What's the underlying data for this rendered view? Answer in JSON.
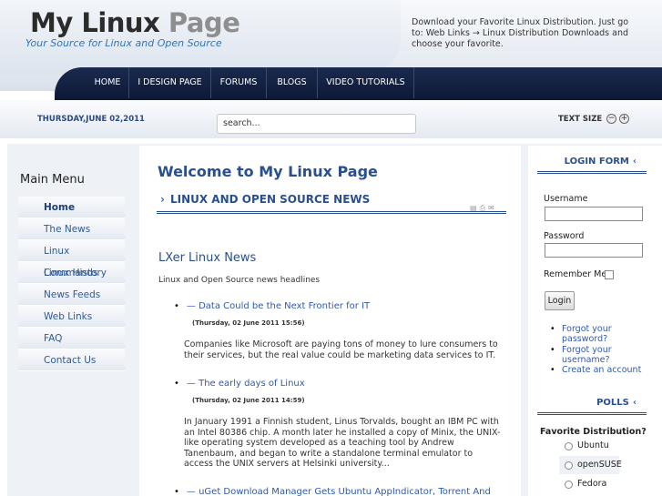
{
  "header": {
    "logo_main": "My Linux",
    "logo_page": "Page",
    "tagline": "Your Source for Linux and Open Source",
    "note": "Download your Favorite Linux Distribution. Just go to: Web Links → Linux Distribution Downloads and choose your favorite."
  },
  "nav": {
    "items": [
      "HOME",
      "I DESIGN PAGE",
      "FORUMS",
      "BLOGS",
      "VIDEO TUTORIALS"
    ]
  },
  "toolbar": {
    "date": "THURSDAY,JUNE 02,2011",
    "search_value": "search...",
    "text_size_label": "TEXT SIZE",
    "decrease_glyph": "−",
    "increase_glyph": "+"
  },
  "sidebar": {
    "title": "Main Menu",
    "items": [
      "Home",
      "The News",
      "Linux Commands",
      "Linux History",
      "News Feeds",
      "Web Links",
      "FAQ",
      "Contact Us"
    ]
  },
  "main": {
    "welcome": "Welcome to My Linux Page",
    "section": "LINUX AND OPEN SOURCE NEWS",
    "feed_title": "LXer Linux News",
    "feed_subtitle": "Linux and Open Source news headlines",
    "news": [
      {
        "title": "— Data Could be the Next Frontier for IT",
        "date": "(Thursday, 02 June 2011 15:56)",
        "body": "Companies like Microsoft are paying tons of money to lure consumers to their services, but the real value could be marketing data services to IT."
      },
      {
        "title": "— The early days of Linux",
        "date": "(Thursday, 02 June 2011 14:59)",
        "body": "In January 1991 a Finnish student, Linus Torvalds, bought an IBM PC with an Intel 80386 chip. A month later he installed a copy of Minix, the UNIX-like operating system developed as a teaching tool by Andrew Tanenbaum, and began to write a standalone terminal emulator to access the UNIX servers at Helsinki university..."
      },
      {
        "title": "— uGet Download Manager Gets Ubuntu AppIndicator, Torrent And",
        "date": "",
        "body": ""
      }
    ]
  },
  "login": {
    "title": "LOGIN FORM",
    "username_label": "Username",
    "password_label": "Password",
    "remember_label": "Remember Me",
    "button": "Login",
    "links": [
      "Forgot your password?",
      "Forgot your username?",
      "Create an account"
    ]
  },
  "polls": {
    "title": "POLLS",
    "question": "Favorite Distribution?",
    "options": [
      "Ubuntu",
      "openSUSE",
      "Fedora"
    ]
  }
}
